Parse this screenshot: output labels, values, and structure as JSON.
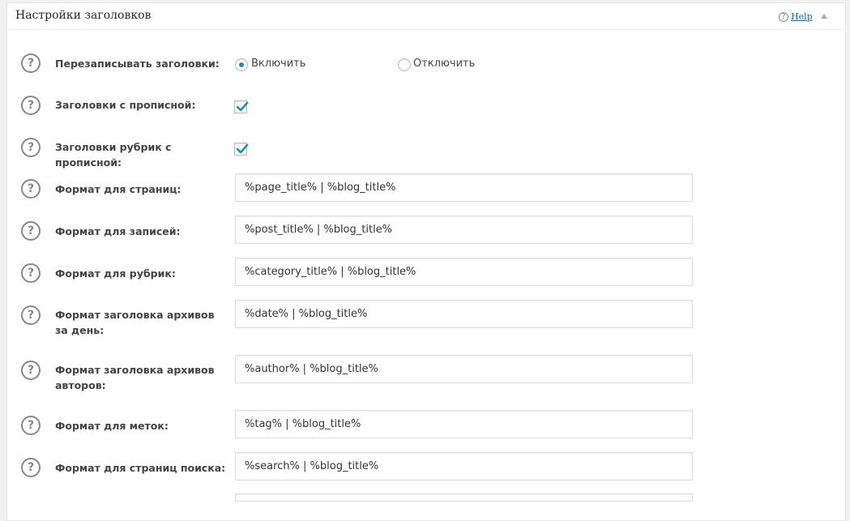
{
  "panel": {
    "title": "Настройки заголовков",
    "help_label": "Help"
  },
  "help_icon_glyph": "?",
  "fields": {
    "rewrite_titles": {
      "label": "Перезаписывать заголовки:",
      "option_on": "Включить",
      "option_off": "Отключить",
      "selected": "on"
    },
    "capitalize_titles": {
      "label": "Заголовки с прописной:",
      "checked": true
    },
    "capitalize_category_titles": {
      "label": "Заголовки рубрик с прописной:",
      "checked": true
    },
    "page_format": {
      "label": "Формат для страниц:",
      "value": "%page_title% | %blog_title%"
    },
    "post_format": {
      "label": "Формат для записей:",
      "value": "%post_title% | %blog_title%"
    },
    "category_format": {
      "label": "Формат для рубрик:",
      "value": "%category_title% | %blog_title%"
    },
    "date_archive_format": {
      "label": "Формат заголовка архивов за день:",
      "value": "%date% | %blog_title%"
    },
    "author_archive_format": {
      "label": "Формат заголовка архивов авторов:",
      "value": "%author% | %blog_title%"
    },
    "tag_format": {
      "label": "Формат для меток:",
      "value": "%tag% | %blog_title%"
    },
    "search_format": {
      "label": "Формат для страниц поиска:",
      "value": "%search% | %blog_title%"
    }
  },
  "colors": {
    "accent": "#1e8cbe",
    "link": "#0073aa",
    "label_text": "#444444",
    "border": "#dddddd"
  },
  "icons": {
    "help": "question-circle",
    "collapse": "triangle-up",
    "check": "checkmark"
  }
}
